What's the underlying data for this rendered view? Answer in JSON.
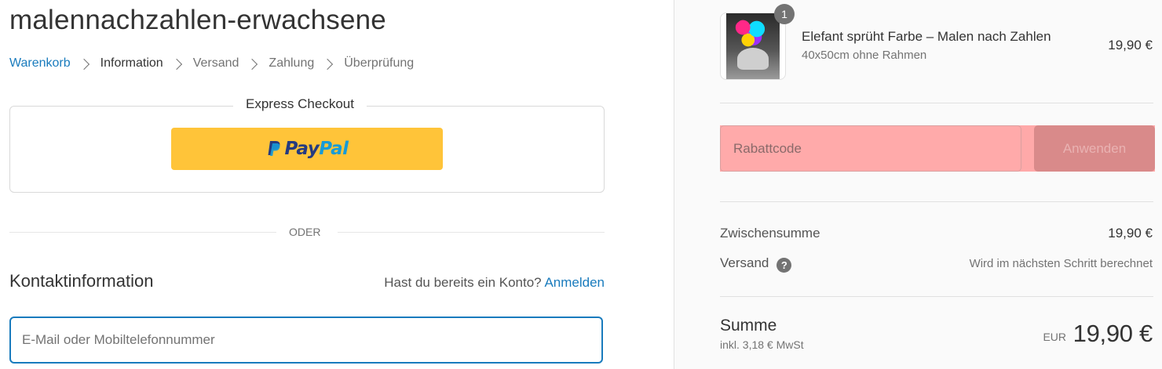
{
  "shop": {
    "title": "malennachzahlen-erwachsene"
  },
  "breadcrumb": [
    "Warenkorb",
    "Information",
    "Versand",
    "Zahlung",
    "Überprüfung"
  ],
  "express": {
    "legend": "Express Checkout",
    "paypal_pay": "Pay",
    "paypal_pal": "Pal",
    "paypal_color": "#ffc439"
  },
  "divider_text": "ODER",
  "contact": {
    "title": "Kontaktinformation",
    "account_question": "Hast du bereits ein Konto?",
    "login_link": "Anmelden",
    "email_placeholder": "E-Mail oder Mobiltelefonnummer"
  },
  "cart": {
    "item": {
      "quantity": "1",
      "name": "Elefant sprüht Farbe – Malen nach Zahlen",
      "variant": "40x50cm ohne Rahmen",
      "price": "19,90 €"
    },
    "discount": {
      "placeholder": "Rabattcode",
      "apply_label": "Anwenden"
    },
    "subtotal_label": "Zwischensumme",
    "subtotal_value": "19,90 €",
    "shipping_label": "Versand",
    "shipping_value": "Wird im nächsten Schritt berechnet",
    "total_label": "Summe",
    "tax_note": "inkl. 3,18 € MwSt",
    "currency": "EUR",
    "total_value": "19,90 €"
  },
  "colors": {
    "link": "#197bbd",
    "discount_highlight": "#ff9a9a"
  }
}
